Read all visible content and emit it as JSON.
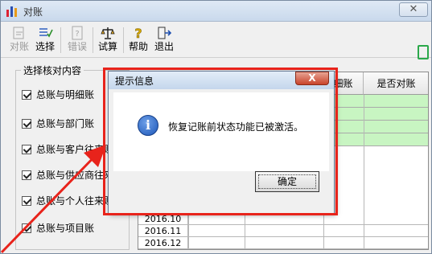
{
  "window": {
    "title": "对账",
    "close_glyph": "✕"
  },
  "toolbar": {
    "buttons": [
      {
        "label": "对账",
        "icon": "reconcile-icon",
        "enabled": false
      },
      {
        "label": "选择",
        "icon": "select-icon",
        "enabled": true
      },
      {
        "label": "错误",
        "icon": "error-icon",
        "enabled": false
      },
      {
        "label": "试算",
        "icon": "scale-icon",
        "enabled": true
      },
      {
        "label": "帮助",
        "icon": "help-icon",
        "enabled": true
      },
      {
        "label": "退出",
        "icon": "exit-icon",
        "enabled": true
      }
    ]
  },
  "group": {
    "legend": "选择核对内容",
    "items": [
      {
        "label": "总账与明细账",
        "checked": true
      },
      {
        "label": "总账与部门账",
        "checked": true
      },
      {
        "label": "总账与客户往来账",
        "checked": true
      },
      {
        "label": "总账与供应商往来账",
        "checked": true
      },
      {
        "label": "总账与个人往来账",
        "checked": true
      },
      {
        "label": "总账与项目账",
        "checked": true
      }
    ]
  },
  "grid": {
    "headers": [
      "细账",
      "是否对账"
    ],
    "rows": [
      "2016.10",
      "2016.11",
      "2016.12"
    ]
  },
  "dialog": {
    "title": "提示信息",
    "close_glyph": "X",
    "message": "恢复记账前状态功能已被激活。",
    "ok_label": "确定",
    "info_glyph": "i"
  },
  "colors": {
    "highlight": "#e8231b",
    "matched_row": "#c8f5c2"
  }
}
